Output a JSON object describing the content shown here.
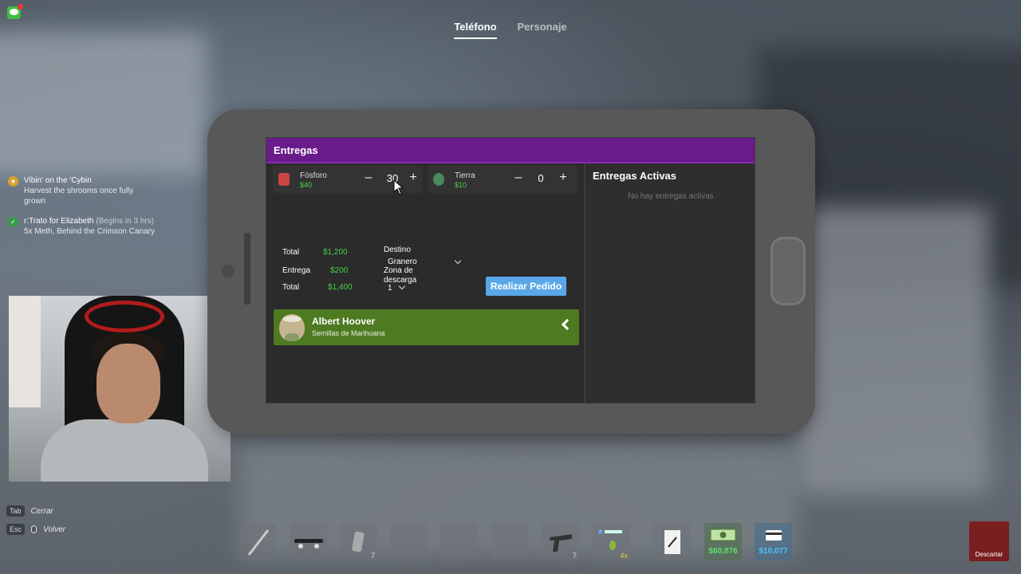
{
  "top_tabs": {
    "phone": "Teléfono",
    "character": "Personaje"
  },
  "quests": [
    {
      "title": "Vibin' on the 'Cybin",
      "desc": "Harvest the shrooms once fully grown"
    },
    {
      "title": "r:Trato for Elizabeth",
      "title_muted": "(Begins in 3 hrs)",
      "desc": "5x Meth, Behind the Crimson Canary"
    }
  ],
  "hints": [
    {
      "key": "Tab",
      "label": "Cerrar"
    },
    {
      "key": "Esc",
      "label": "Volver"
    }
  ],
  "app": {
    "title": "Entregas",
    "products": [
      {
        "name": "Fósforo",
        "price": "$40",
        "qty": "30",
        "icon": "match-box-icon"
      },
      {
        "name": "Tierra",
        "price": "$10",
        "qty": "0",
        "icon": "soil-bag-icon"
      }
    ],
    "totals": {
      "subtotal_label": "Total",
      "subtotal_value": "$1,200",
      "delivery_label": "Entrega",
      "delivery_value": "$200",
      "total_label": "Total",
      "total_value": "$1,400"
    },
    "destination": {
      "label": "Destino",
      "selected": "Granero",
      "zone_label": "Zona de descarga",
      "zone_selected": "1"
    },
    "order_button": "Realizar Pedido",
    "supplier": {
      "name": "Albert Hoover",
      "desc": "Semillas de Marihuana"
    },
    "active": {
      "title": "Entregas Activas",
      "empty": "No hay entregas activas"
    }
  },
  "hotbar": {
    "slot_counts": [
      "",
      "",
      "7",
      "",
      "",
      "",
      "7",
      "4x"
    ],
    "cash": "$60,876",
    "card": "$10,077",
    "discard": "Descartar"
  },
  "colors": {
    "header": "#6a1b8a",
    "price": "#46d14a",
    "button": "#5aa7e8",
    "supplier": "#4e7a22"
  }
}
